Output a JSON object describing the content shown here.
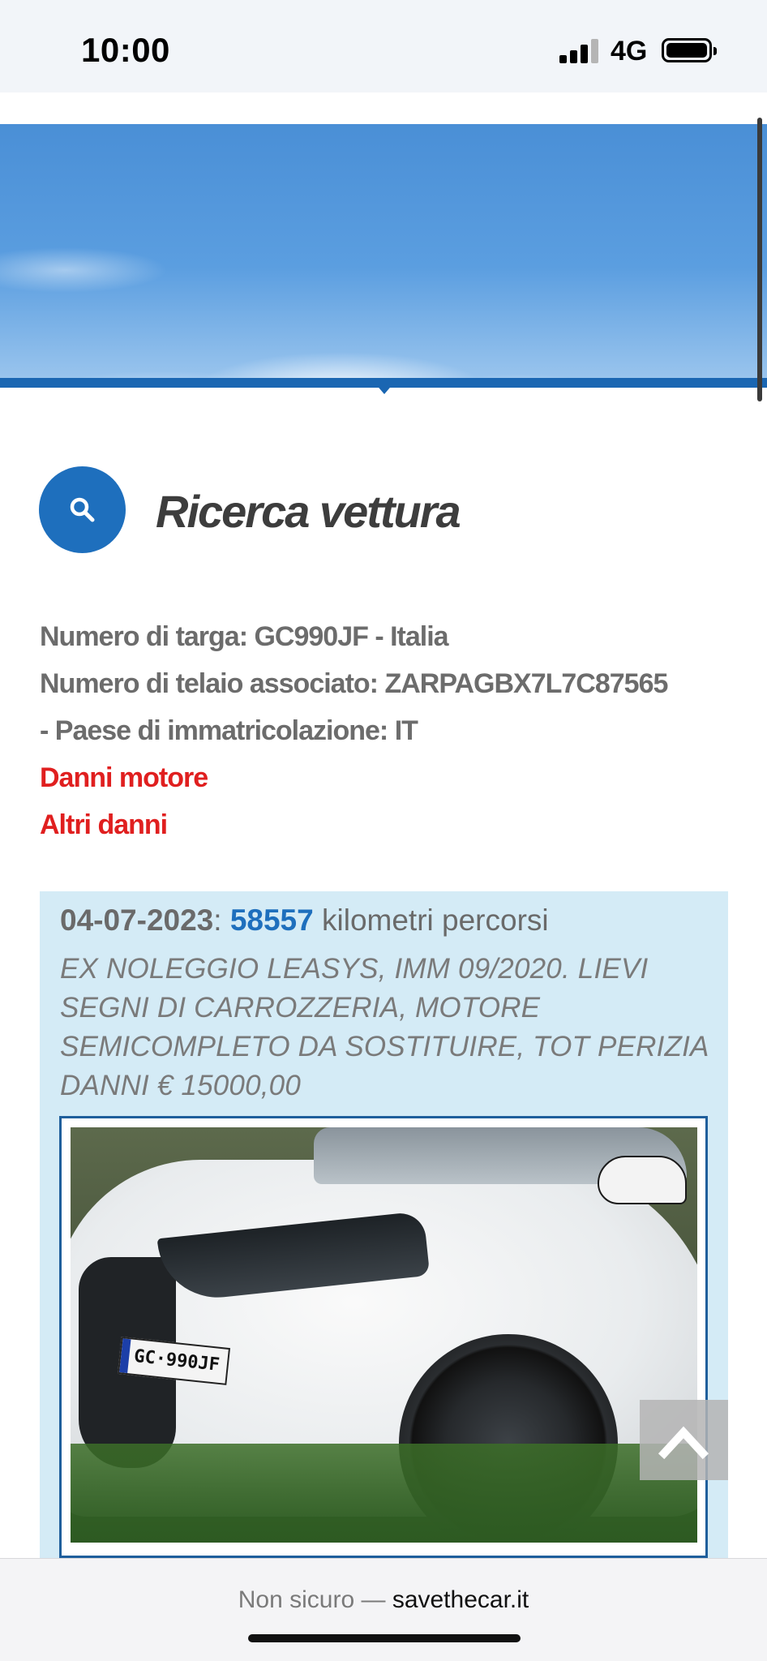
{
  "status_bar": {
    "time": "10:00",
    "network": "4G"
  },
  "header": {
    "title": "Ricerca vettura"
  },
  "vehicle_info": {
    "plate_line": "Numero di targa: GC990JF - Italia",
    "vin_line": "Numero di telaio associato: ZARPAGBX7L7C87565",
    "country_line": "- Paese di immatricolazione: IT",
    "damage_1": "Danni motore",
    "damage_2": "Altri danni"
  },
  "report": {
    "date": "04-07-2023",
    "separator": ":",
    "km": "58557",
    "km_label": "kilometri percorsi",
    "description": "EX NOLEGGIO LEASYS, IMM 09/2020. LIEVI SEGNI DI CARROZZERIA, MOTORE SEMICOMPLETO DA SOSTITUIRE, TOT PERIZIA DANNI € 15000,00",
    "photo_plate": "GC·990JF"
  },
  "browser": {
    "insecure_label": "Non sicuro —",
    "domain": "savethecar.it"
  },
  "colors": {
    "accent": "#1e6fbd",
    "damage": "#e01f1f",
    "panel": "#d4ebf6"
  },
  "icons": {
    "search": "search-icon",
    "back_to_top": "chevron-up-icon"
  }
}
